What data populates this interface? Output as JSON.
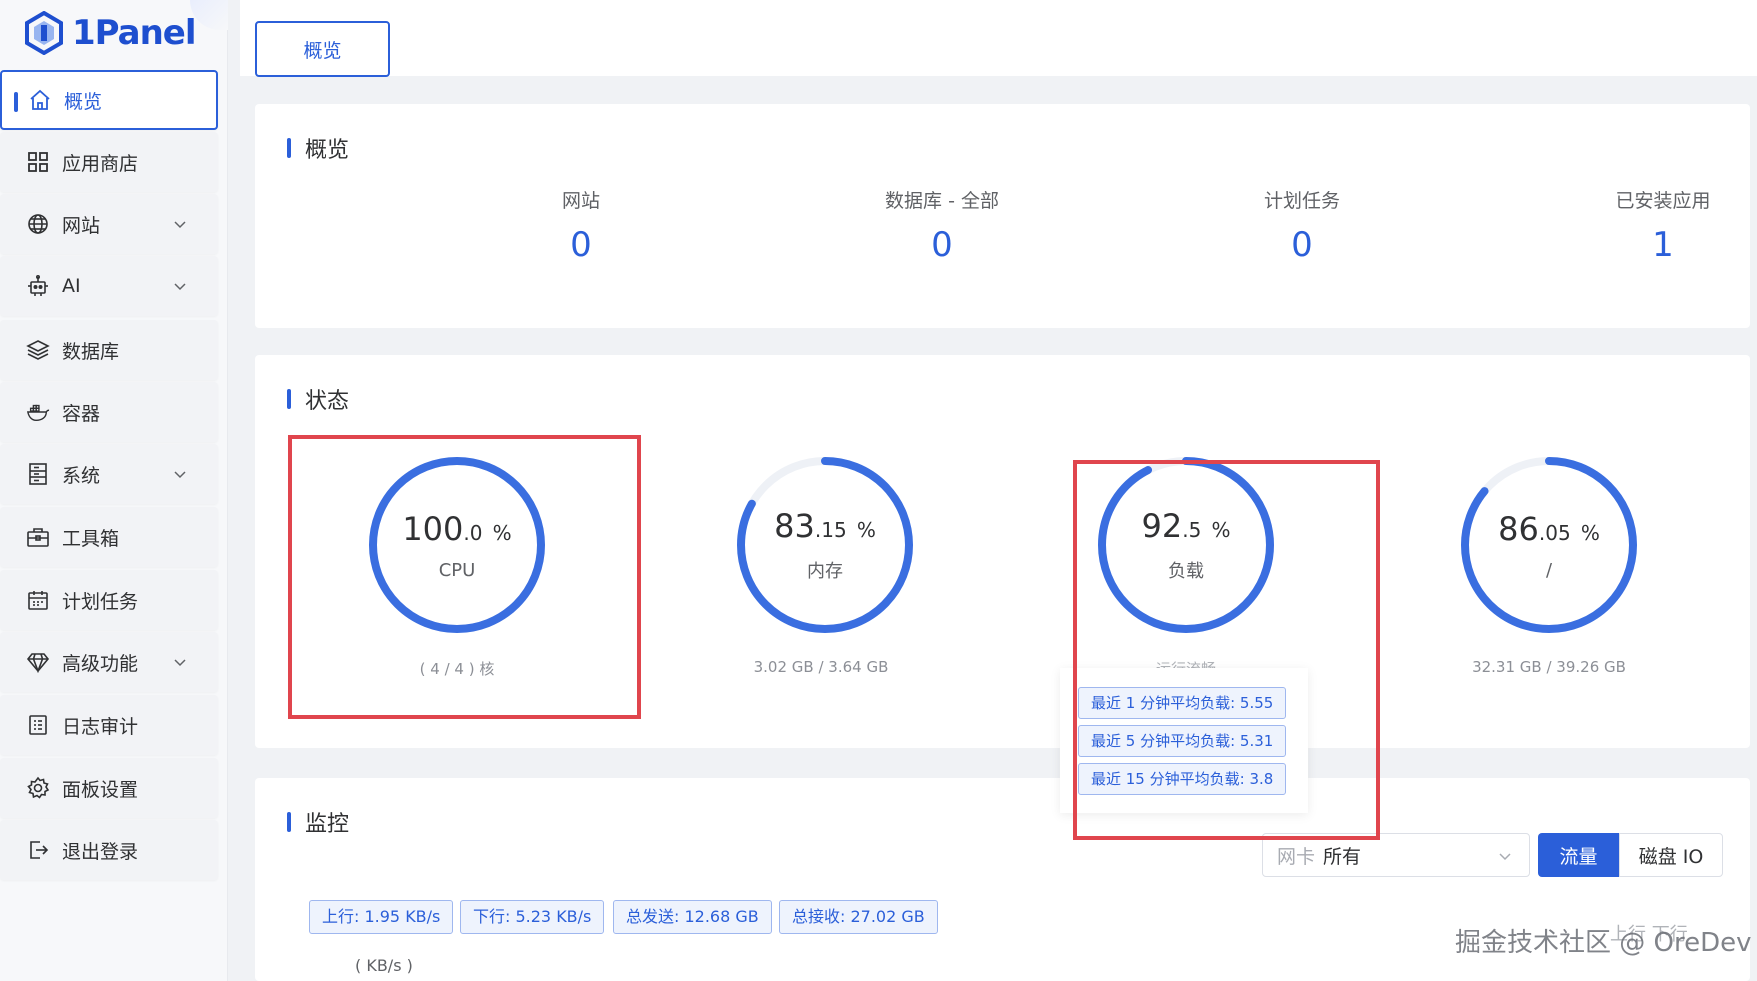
{
  "brand": {
    "name": "1Panel"
  },
  "sidebar": {
    "items": [
      {
        "label": "概览",
        "icon": "home-icon",
        "active": true,
        "expandable": false
      },
      {
        "label": "应用商店",
        "icon": "grid-icon",
        "expandable": false
      },
      {
        "label": "网站",
        "icon": "globe-icon",
        "expandable": true
      },
      {
        "label": "AI",
        "icon": "robot-icon",
        "expandable": true
      },
      {
        "label": "数据库",
        "icon": "layers-icon",
        "expandable": false
      },
      {
        "label": "容器",
        "icon": "docker-icon",
        "expandable": false
      },
      {
        "label": "系统",
        "icon": "server-icon",
        "expandable": true
      },
      {
        "label": "工具箱",
        "icon": "toolbox-icon",
        "expandable": false
      },
      {
        "label": "计划任务",
        "icon": "calendar-icon",
        "expandable": false
      },
      {
        "label": "高级功能",
        "icon": "diamond-icon",
        "expandable": true
      },
      {
        "label": "日志审计",
        "icon": "log-icon",
        "expandable": false
      },
      {
        "label": "面板设置",
        "icon": "gear-icon",
        "expandable": false
      },
      {
        "label": "退出登录",
        "icon": "logout-icon",
        "expandable": false
      }
    ]
  },
  "tabs": [
    {
      "label": "概览"
    }
  ],
  "overview": {
    "title": "概览",
    "stats": [
      {
        "label": "网站",
        "value": "0"
      },
      {
        "label": "数据库 - 全部",
        "value": "0"
      },
      {
        "label": "计划任务",
        "value": "0"
      },
      {
        "label": "已安装应用",
        "value": "1"
      }
    ]
  },
  "status": {
    "title": "状态",
    "gauges": [
      {
        "int": "100",
        "dec": ".0",
        "unit": "%",
        "label": "CPU",
        "sub": "( 4 / 4 ) 核",
        "percent": 100.0
      },
      {
        "int": "83",
        "dec": ".15",
        "unit": "%",
        "label": "内存",
        "sub": "3.02 GB / 3.64 GB",
        "percent": 83.15
      },
      {
        "int": "92",
        "dec": ".5",
        "unit": "%",
        "label": "负载",
        "sub": "运行流畅",
        "percent": 92.5
      },
      {
        "int": "86",
        "dec": ".05",
        "unit": "%",
        "label": "/",
        "sub": "32.31 GB / 39.26 GB",
        "percent": 86.05
      }
    ],
    "load_tooltip": [
      "最近 1 分钟平均负载: 5.55",
      "最近 5 分钟平均负载: 5.31",
      "最近 15 分钟平均负载: 3.8"
    ]
  },
  "monitor": {
    "title": "监控",
    "nic_select": {
      "placeholder": "网卡",
      "value": "所有"
    },
    "btn_traffic": "流量",
    "btn_disk": "磁盘 IO",
    "tags": [
      "上行: 1.95 KB/s",
      "下行: 5.23 KB/s",
      "总发送: 12.68 GB",
      "总接收: 27.02 GB"
    ],
    "unit": "( KB/s )",
    "pager": "上行    下行"
  },
  "watermark": "掘金技术社区 @ OreDev",
  "colors": {
    "accent": "#2b5fd9",
    "highlight": "#e0454d"
  }
}
